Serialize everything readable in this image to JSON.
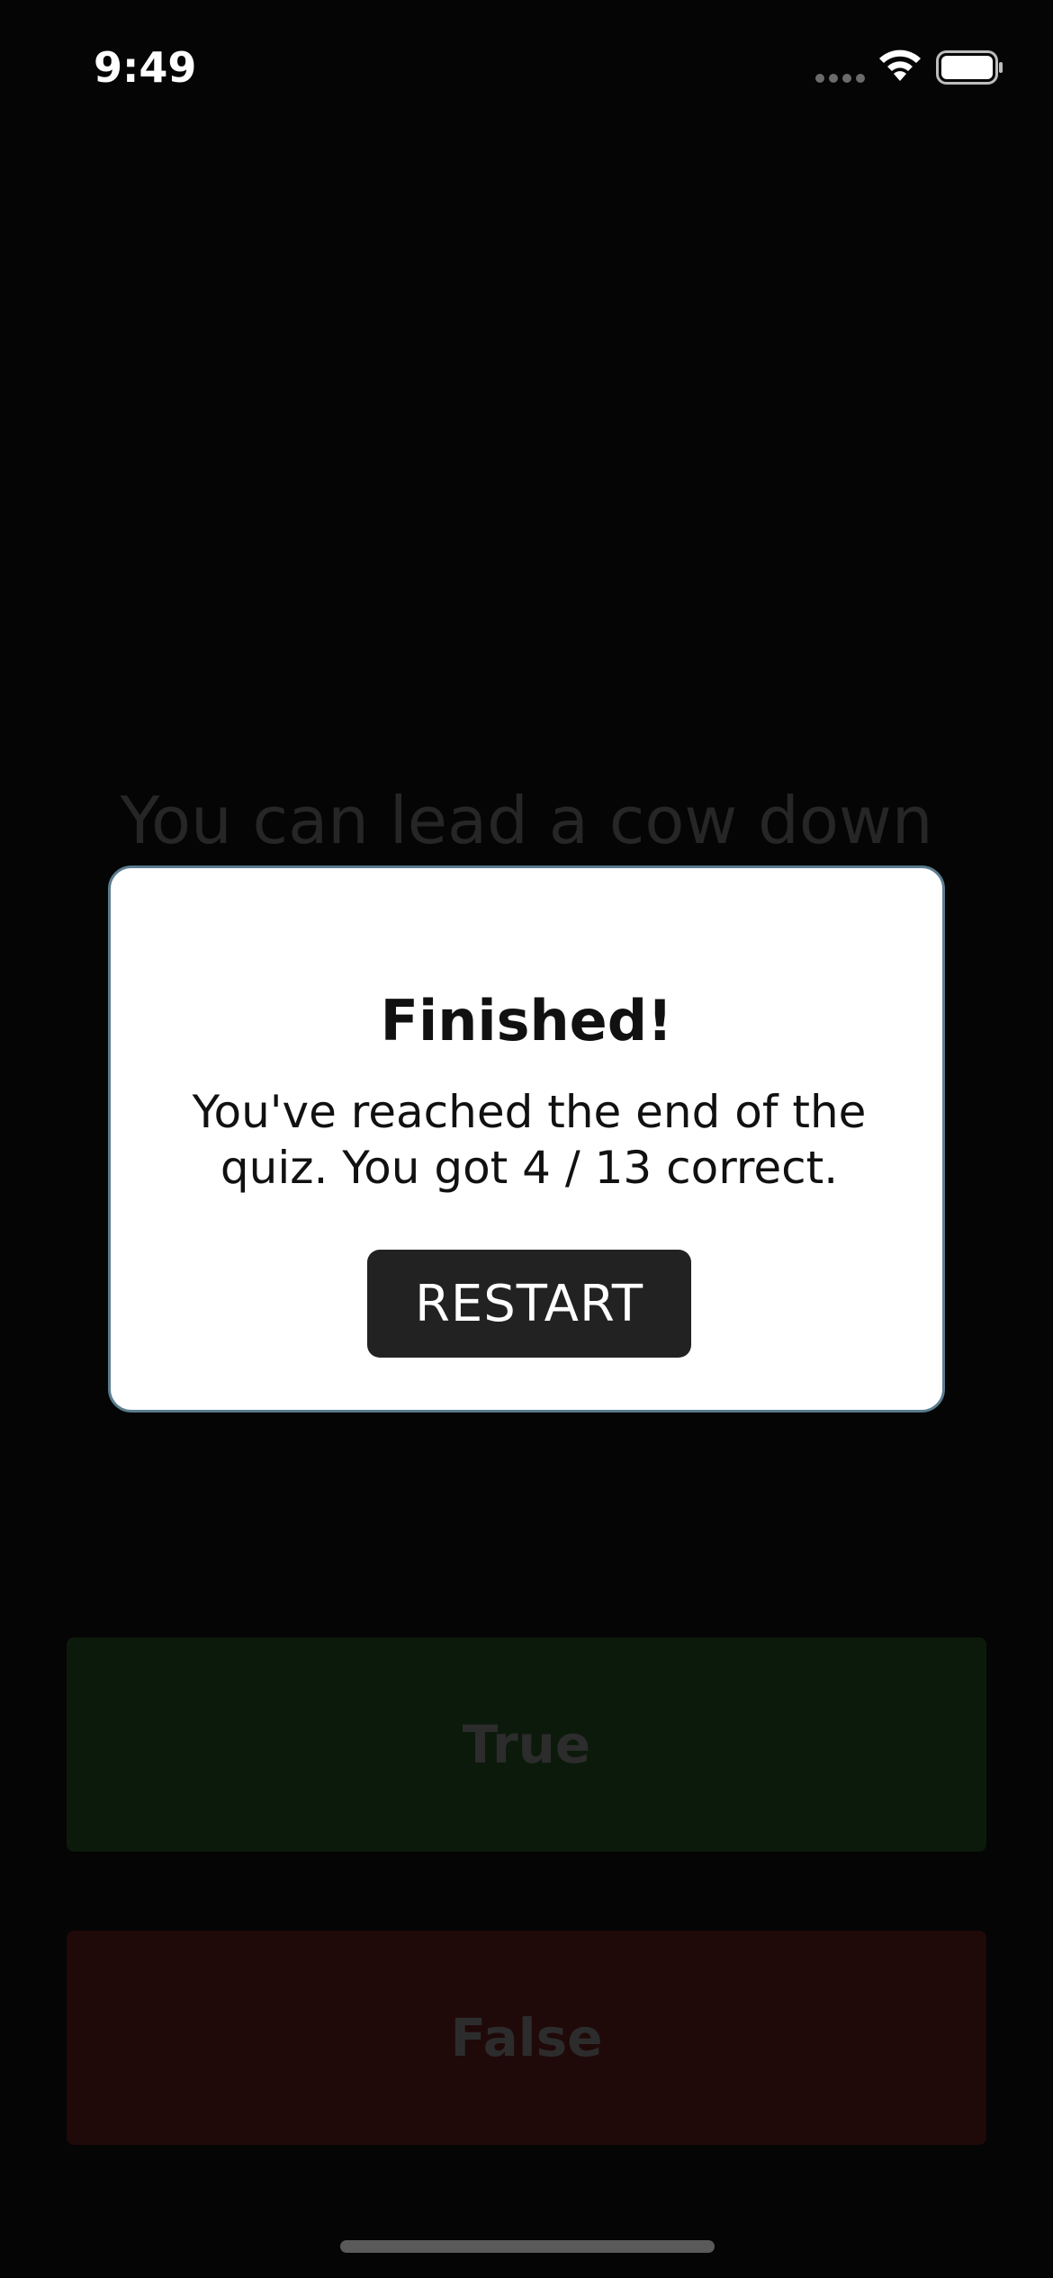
{
  "status_bar": {
    "time": "9:49",
    "icons": [
      "cellular-dots-icon",
      "wifi-icon",
      "battery-icon"
    ]
  },
  "quiz": {
    "question": "You can lead a cow down"
  },
  "answers": {
    "true_label": "True",
    "false_label": "False"
  },
  "modal": {
    "title": "Finished!",
    "message": "You've reached the end of the quiz. You got 4 / 13 correct.",
    "restart_label": "RESTART"
  },
  "colors": {
    "background": "#050505",
    "modal_background": "#ffffff",
    "modal_border": "#5b7d8e",
    "restart_button": "#222222",
    "true_button_dimmed": "#0c1a0c",
    "false_button_dimmed": "#200909"
  }
}
